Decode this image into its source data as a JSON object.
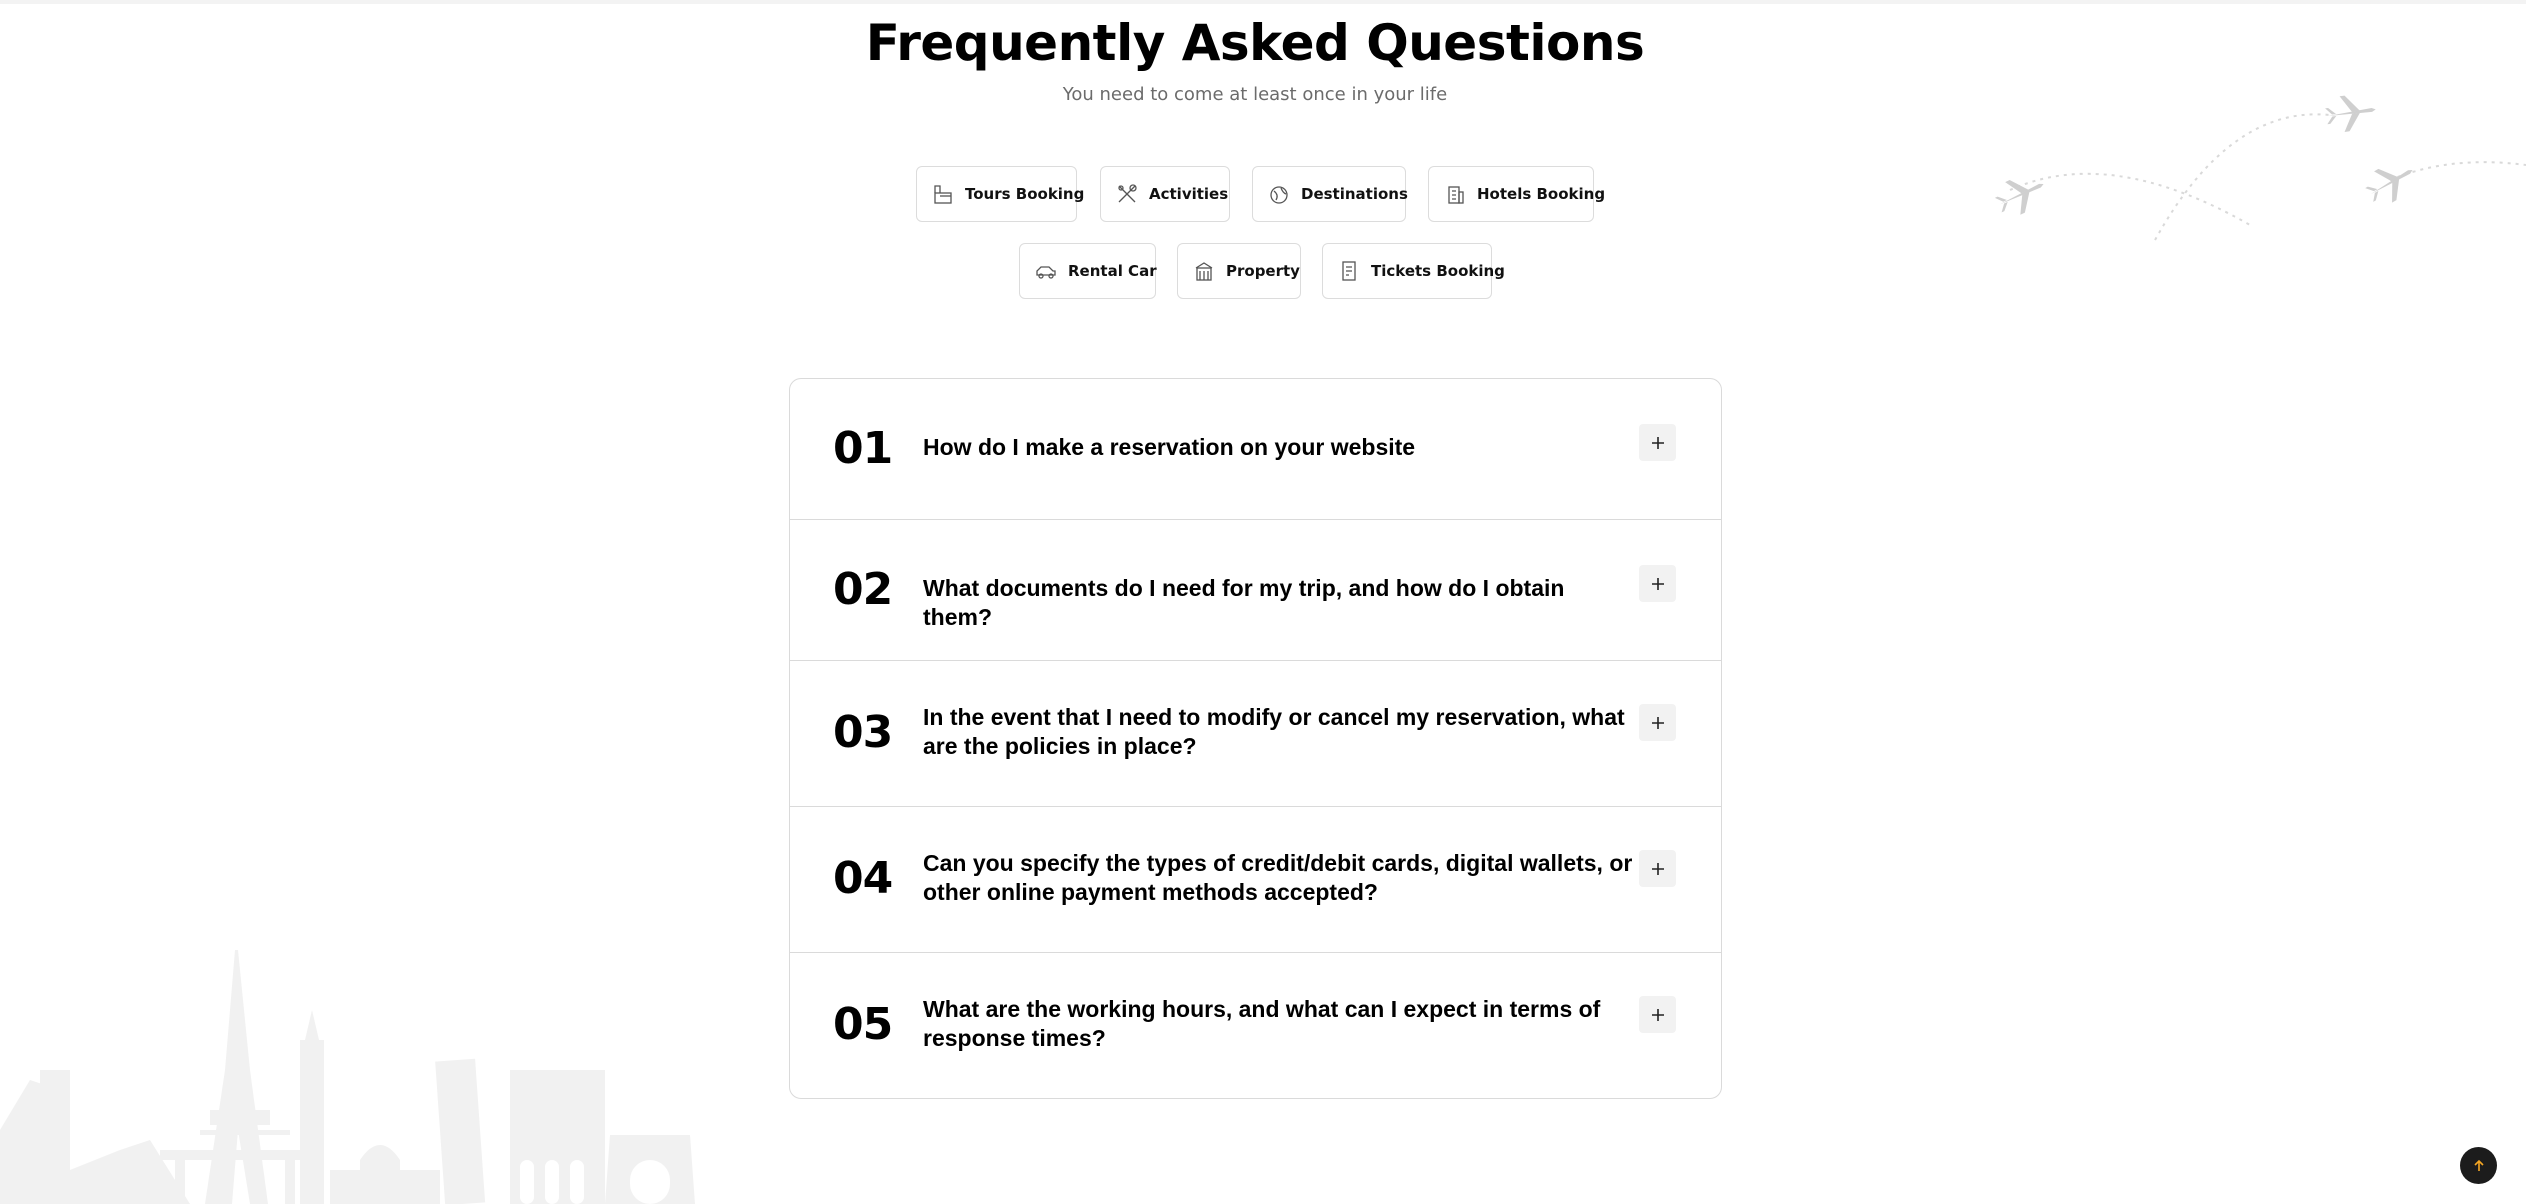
{
  "header": {
    "title": "Frequently Asked Questions",
    "subtitle": "You need to come at least once in your life"
  },
  "categories": [
    {
      "label": "Tours Booking",
      "icon": "tours-booking-icon"
    },
    {
      "label": "Activities",
      "icon": "activities-icon"
    },
    {
      "label": "Destinations",
      "icon": "destinations-icon"
    },
    {
      "label": "Hotels Booking",
      "icon": "hotels-booking-icon"
    },
    {
      "label": "Rental Car",
      "icon": "rental-car-icon"
    },
    {
      "label": "Property",
      "icon": "property-icon"
    },
    {
      "label": "Tickets Booking",
      "icon": "tickets-booking-icon"
    }
  ],
  "faq": [
    {
      "number": "01",
      "question": "How do I make a reservation on your website"
    },
    {
      "number": "02",
      "question": "What documents do I need for my trip, and how do I obtain them?"
    },
    {
      "number": "03",
      "question": "In the event that I need to modify or cancel my reservation, what are the policies in place?"
    },
    {
      "number": "04",
      "question": "Can you specify the types of credit/debit cards, digital wallets, or other online payment methods accepted?"
    },
    {
      "number": "05",
      "question": "What are the working hours, and what can I expect in terms of response times?"
    }
  ],
  "icons": {
    "expand": "plus-icon",
    "scroll_top": "arrow-up-icon"
  },
  "colors": {
    "text": "#000000",
    "subtitle": "#6b6b6b",
    "border": "#dadada",
    "plus_bg": "#f2f2f2",
    "scroll_top_bg": "#1c1c1c",
    "scroll_top_arrow": "#f5a623"
  }
}
